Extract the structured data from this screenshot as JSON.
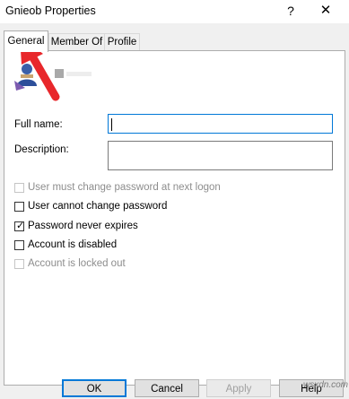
{
  "window": {
    "title": "Gnieob Properties",
    "help_glyph": "?",
    "close_glyph": "✕"
  },
  "tabs": [
    {
      "label": "General",
      "active": true
    },
    {
      "label": "Member Of",
      "active": false
    },
    {
      "label": "Profile",
      "active": false
    }
  ],
  "general": {
    "full_name_label": "Full name:",
    "full_name_value": "",
    "description_label": "Description:",
    "description_value": ""
  },
  "checkboxes": [
    {
      "label": "User must change password at next logon",
      "checked": false,
      "enabled": false
    },
    {
      "label": "User cannot change password",
      "checked": false,
      "enabled": true
    },
    {
      "label": "Password never expires",
      "checked": true,
      "enabled": true
    },
    {
      "label": "Account is disabled",
      "checked": false,
      "enabled": true
    },
    {
      "label": "Account is locked out",
      "checked": false,
      "enabled": false
    }
  ],
  "buttons": {
    "ok": "OK",
    "cancel": "Cancel",
    "apply": "Apply",
    "help": "Help"
  },
  "watermark": "wsxdn.com",
  "colors": {
    "annotation_arrow": "#e8272b",
    "focus_border": "#0078d7"
  }
}
